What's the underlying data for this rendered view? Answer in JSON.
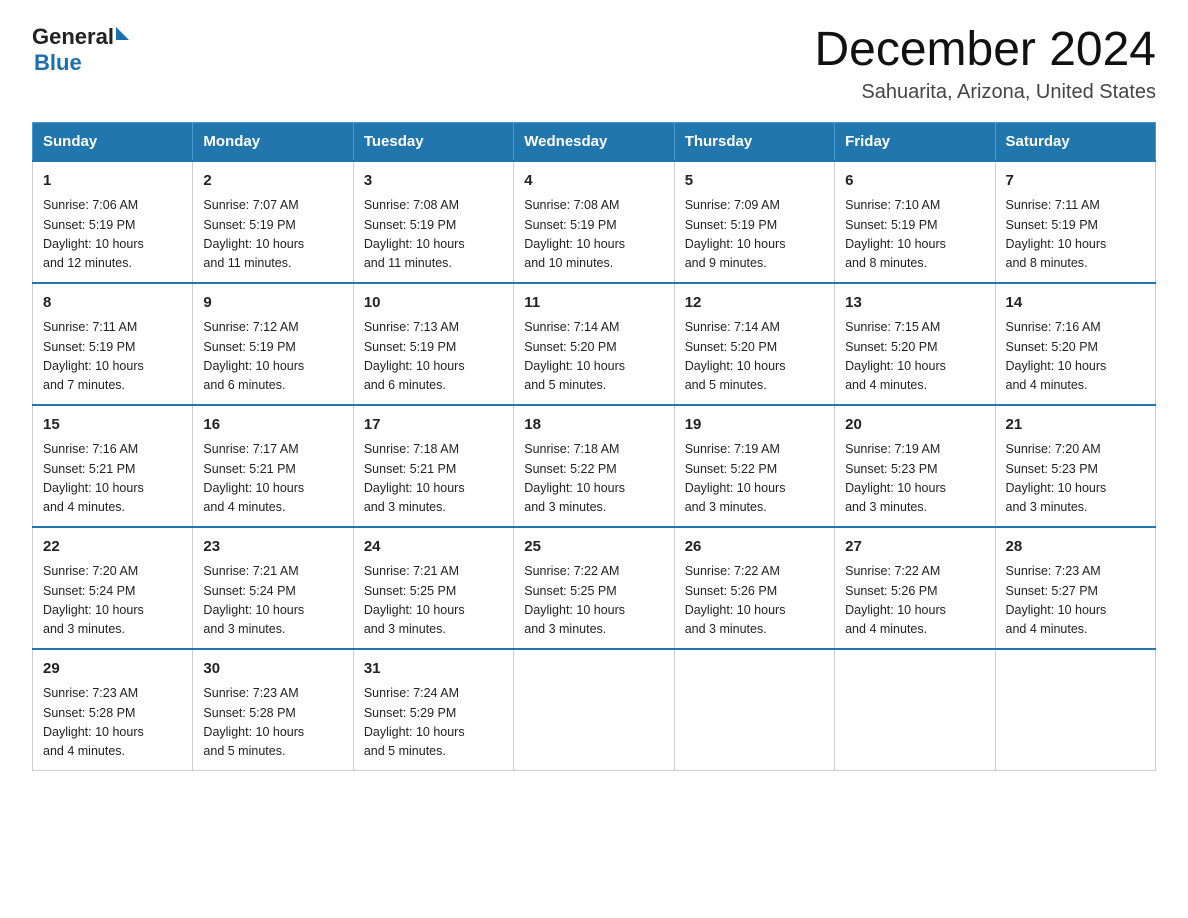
{
  "header": {
    "logo_general": "General",
    "logo_blue": "Blue",
    "month_title": "December 2024",
    "location": "Sahuarita, Arizona, United States"
  },
  "days_of_week": [
    "Sunday",
    "Monday",
    "Tuesday",
    "Wednesday",
    "Thursday",
    "Friday",
    "Saturday"
  ],
  "weeks": [
    [
      {
        "day": "1",
        "sunrise": "7:06 AM",
        "sunset": "5:19 PM",
        "daylight": "10 hours and 12 minutes."
      },
      {
        "day": "2",
        "sunrise": "7:07 AM",
        "sunset": "5:19 PM",
        "daylight": "10 hours and 11 minutes."
      },
      {
        "day": "3",
        "sunrise": "7:08 AM",
        "sunset": "5:19 PM",
        "daylight": "10 hours and 11 minutes."
      },
      {
        "day": "4",
        "sunrise": "7:08 AM",
        "sunset": "5:19 PM",
        "daylight": "10 hours and 10 minutes."
      },
      {
        "day": "5",
        "sunrise": "7:09 AM",
        "sunset": "5:19 PM",
        "daylight": "10 hours and 9 minutes."
      },
      {
        "day": "6",
        "sunrise": "7:10 AM",
        "sunset": "5:19 PM",
        "daylight": "10 hours and 8 minutes."
      },
      {
        "day": "7",
        "sunrise": "7:11 AM",
        "sunset": "5:19 PM",
        "daylight": "10 hours and 8 minutes."
      }
    ],
    [
      {
        "day": "8",
        "sunrise": "7:11 AM",
        "sunset": "5:19 PM",
        "daylight": "10 hours and 7 minutes."
      },
      {
        "day": "9",
        "sunrise": "7:12 AM",
        "sunset": "5:19 PM",
        "daylight": "10 hours and 6 minutes."
      },
      {
        "day": "10",
        "sunrise": "7:13 AM",
        "sunset": "5:19 PM",
        "daylight": "10 hours and 6 minutes."
      },
      {
        "day": "11",
        "sunrise": "7:14 AM",
        "sunset": "5:20 PM",
        "daylight": "10 hours and 5 minutes."
      },
      {
        "day": "12",
        "sunrise": "7:14 AM",
        "sunset": "5:20 PM",
        "daylight": "10 hours and 5 minutes."
      },
      {
        "day": "13",
        "sunrise": "7:15 AM",
        "sunset": "5:20 PM",
        "daylight": "10 hours and 4 minutes."
      },
      {
        "day": "14",
        "sunrise": "7:16 AM",
        "sunset": "5:20 PM",
        "daylight": "10 hours and 4 minutes."
      }
    ],
    [
      {
        "day": "15",
        "sunrise": "7:16 AM",
        "sunset": "5:21 PM",
        "daylight": "10 hours and 4 minutes."
      },
      {
        "day": "16",
        "sunrise": "7:17 AM",
        "sunset": "5:21 PM",
        "daylight": "10 hours and 4 minutes."
      },
      {
        "day": "17",
        "sunrise": "7:18 AM",
        "sunset": "5:21 PM",
        "daylight": "10 hours and 3 minutes."
      },
      {
        "day": "18",
        "sunrise": "7:18 AM",
        "sunset": "5:22 PM",
        "daylight": "10 hours and 3 minutes."
      },
      {
        "day": "19",
        "sunrise": "7:19 AM",
        "sunset": "5:22 PM",
        "daylight": "10 hours and 3 minutes."
      },
      {
        "day": "20",
        "sunrise": "7:19 AM",
        "sunset": "5:23 PM",
        "daylight": "10 hours and 3 minutes."
      },
      {
        "day": "21",
        "sunrise": "7:20 AM",
        "sunset": "5:23 PM",
        "daylight": "10 hours and 3 minutes."
      }
    ],
    [
      {
        "day": "22",
        "sunrise": "7:20 AM",
        "sunset": "5:24 PM",
        "daylight": "10 hours and 3 minutes."
      },
      {
        "day": "23",
        "sunrise": "7:21 AM",
        "sunset": "5:24 PM",
        "daylight": "10 hours and 3 minutes."
      },
      {
        "day": "24",
        "sunrise": "7:21 AM",
        "sunset": "5:25 PM",
        "daylight": "10 hours and 3 minutes."
      },
      {
        "day": "25",
        "sunrise": "7:22 AM",
        "sunset": "5:25 PM",
        "daylight": "10 hours and 3 minutes."
      },
      {
        "day": "26",
        "sunrise": "7:22 AM",
        "sunset": "5:26 PM",
        "daylight": "10 hours and 3 minutes."
      },
      {
        "day": "27",
        "sunrise": "7:22 AM",
        "sunset": "5:26 PM",
        "daylight": "10 hours and 4 minutes."
      },
      {
        "day": "28",
        "sunrise": "7:23 AM",
        "sunset": "5:27 PM",
        "daylight": "10 hours and 4 minutes."
      }
    ],
    [
      {
        "day": "29",
        "sunrise": "7:23 AM",
        "sunset": "5:28 PM",
        "daylight": "10 hours and 4 minutes."
      },
      {
        "day": "30",
        "sunrise": "7:23 AM",
        "sunset": "5:28 PM",
        "daylight": "10 hours and 5 minutes."
      },
      {
        "day": "31",
        "sunrise": "7:24 AM",
        "sunset": "5:29 PM",
        "daylight": "10 hours and 5 minutes."
      },
      null,
      null,
      null,
      null
    ]
  ],
  "labels": {
    "sunrise": "Sunrise:",
    "sunset": "Sunset:",
    "daylight": "Daylight:"
  }
}
